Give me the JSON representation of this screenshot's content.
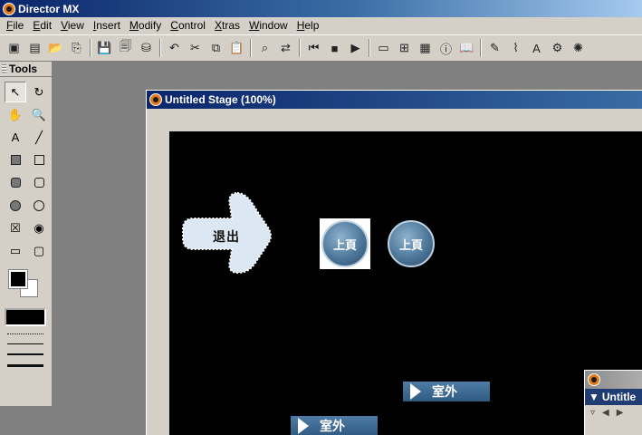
{
  "app": {
    "title": "Director MX"
  },
  "menu": [
    "File",
    "Edit",
    "View",
    "Insert",
    "Modify",
    "Control",
    "Xtras",
    "Window",
    "Help"
  ],
  "toolbar": {
    "groups": [
      [
        {
          "name": "new-movie-icon",
          "glyph": "▣"
        },
        {
          "name": "new-cast-icon",
          "glyph": "▤"
        },
        {
          "name": "open-icon",
          "glyph": "📂"
        },
        {
          "name": "import-icon",
          "glyph": "⎘"
        }
      ],
      [
        {
          "name": "save-icon",
          "glyph": "💾"
        },
        {
          "name": "save-all-icon",
          "glyph": "🗐"
        },
        {
          "name": "publish-icon",
          "glyph": "⛁"
        }
      ],
      [
        {
          "name": "undo-icon",
          "glyph": "↶"
        },
        {
          "name": "cut-icon",
          "glyph": "✂"
        },
        {
          "name": "copy-icon",
          "glyph": "⧉"
        },
        {
          "name": "paste-icon",
          "glyph": "📋"
        }
      ],
      [
        {
          "name": "find-icon",
          "glyph": "⌕"
        },
        {
          "name": "exchange-cast-icon",
          "glyph": "⇄"
        }
      ],
      [
        {
          "name": "rewind-icon",
          "glyph": "⏮"
        },
        {
          "name": "stop-icon",
          "glyph": "■"
        },
        {
          "name": "play-icon",
          "glyph": "▶"
        }
      ],
      [
        {
          "name": "stage-icon",
          "glyph": "▭"
        },
        {
          "name": "cast-window-icon",
          "glyph": "⊞"
        },
        {
          "name": "score-icon",
          "glyph": "▦"
        },
        {
          "name": "property-inspector-icon",
          "glyph": "ⓘ"
        },
        {
          "name": "library-icon",
          "glyph": "📖"
        }
      ],
      [
        {
          "name": "paint-icon",
          "glyph": "✎"
        },
        {
          "name": "vector-icon",
          "glyph": "⌇"
        },
        {
          "name": "text-icon",
          "glyph": "A"
        },
        {
          "name": "script-icon",
          "glyph": "⚙"
        },
        {
          "name": "message-icon",
          "glyph": "✺"
        }
      ]
    ]
  },
  "tools": {
    "title": "Tools",
    "items": [
      {
        "name": "arrow-tool-icon",
        "glyph": "↖",
        "selected": true
      },
      {
        "name": "rotate-tool-icon",
        "glyph": "↻"
      },
      {
        "name": "hand-tool-icon",
        "glyph": "✋"
      },
      {
        "name": "zoom-tool-icon",
        "glyph": "🔍"
      },
      {
        "name": "text-tool-icon",
        "glyph": "A"
      },
      {
        "name": "line-tool-icon",
        "glyph": "╱"
      },
      {
        "name": "filled-rect-tool-icon",
        "shape": "sq-filled"
      },
      {
        "name": "rect-tool-icon",
        "shape": "sq"
      },
      {
        "name": "filled-roundrect-tool-icon",
        "shape": "rr-filled"
      },
      {
        "name": "roundrect-tool-icon",
        "shape": "rr"
      },
      {
        "name": "filled-ellipse-tool-icon",
        "shape": "ci-filled"
      },
      {
        "name": "ellipse-tool-icon",
        "shape": "ci"
      },
      {
        "name": "checkbox-tool-icon",
        "glyph": "☒"
      },
      {
        "name": "radio-tool-icon",
        "glyph": "◉"
      },
      {
        "name": "field-tool-icon",
        "glyph": "▭"
      },
      {
        "name": "button-tool-icon",
        "glyph": "▢"
      }
    ]
  },
  "stage": {
    "title": "Untitled Stage (100%)",
    "exit_label": "退出",
    "round_btn_1": "上頁",
    "round_btn_2": "上頁",
    "bar_btn_1": "室外",
    "bar_btn_2": "室外"
  },
  "mini_window": {
    "tab": "Untitle"
  },
  "colors": {
    "title_active": "#0a246a",
    "chrome": "#d4d0c8",
    "button_blue": "#4d7799"
  }
}
